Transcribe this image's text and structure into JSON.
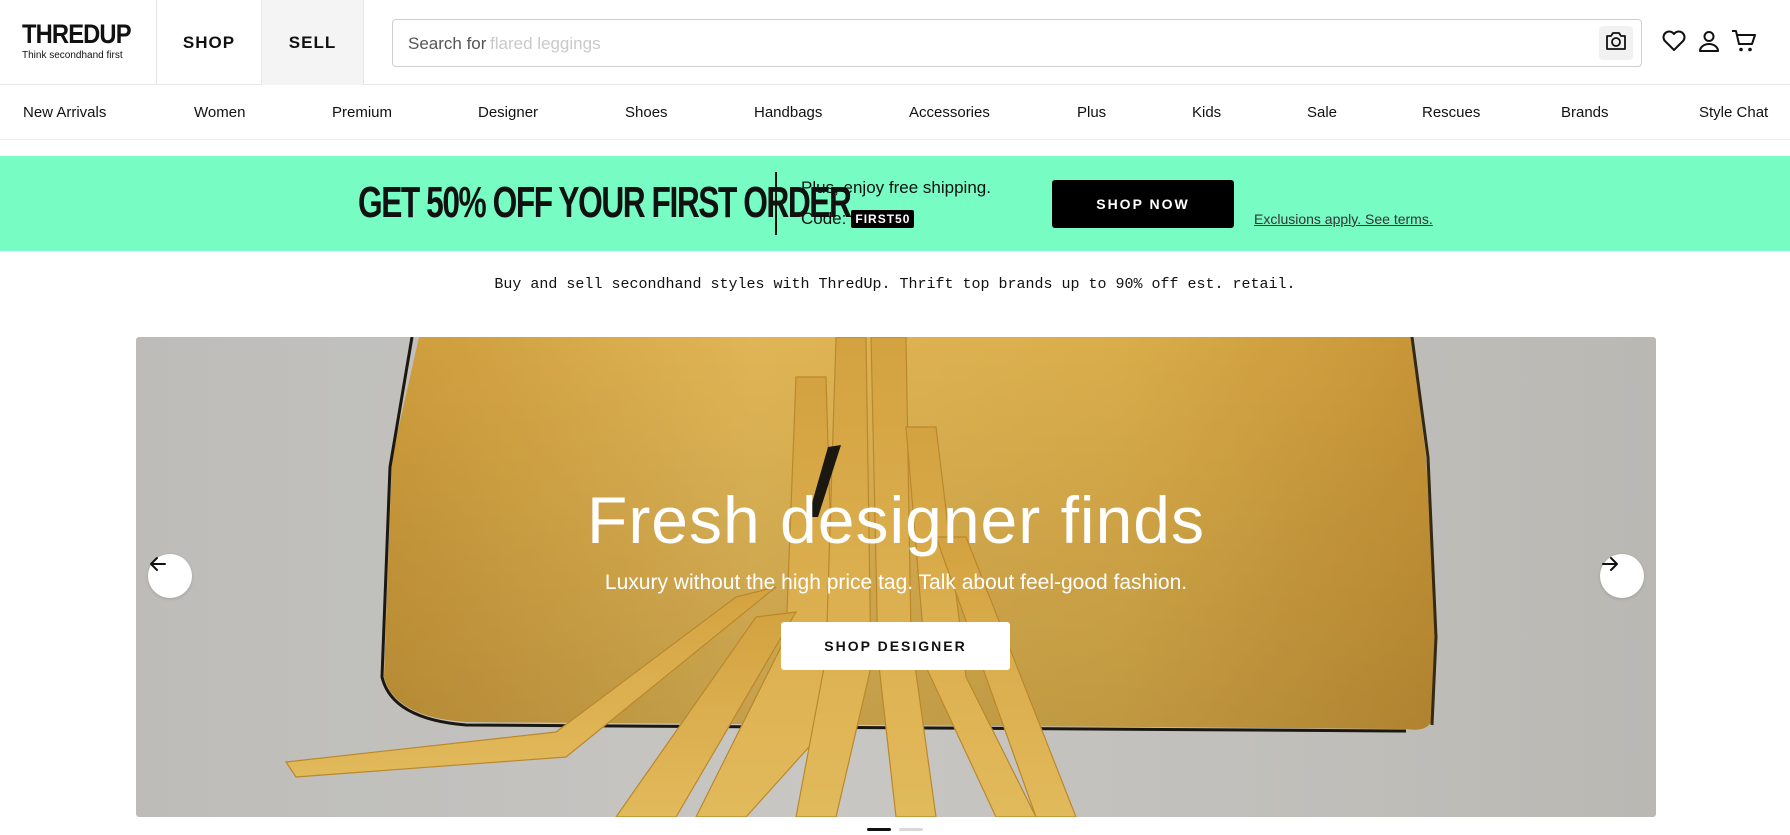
{
  "header": {
    "logo_text": "THREDUP",
    "logo_tagline": "Think secondhand first",
    "shop_label": "SHOP",
    "sell_label": "SELL",
    "search": {
      "prefix": "Search for",
      "placeholder": "flared leggings",
      "value": ""
    },
    "icons": [
      "camera-icon",
      "heart-icon",
      "user-icon",
      "cart-icon"
    ]
  },
  "categories": [
    "New Arrivals",
    "Women",
    "Premium",
    "Designer",
    "Shoes",
    "Handbags",
    "Accessories",
    "Plus",
    "Kids",
    "Sale",
    "Rescues",
    "Brands",
    "Style Chat"
  ],
  "promo": {
    "headline": "GET 50% OFF YOUR FIRST ORDER",
    "shipping": "Plus, enjoy free shipping.",
    "code_label": "Code:",
    "code": "FIRST50",
    "cta": "SHOP NOW",
    "terms": "Exclusions apply. See terms.",
    "bg_color": "#77fcc4"
  },
  "tagline": "Buy and sell secondhand styles with ThredUp. Thrift top brands up to 90% off est. retail.",
  "hero": {
    "title": "Fresh designer finds",
    "subtitle": "Luxury without the high price tag. Talk about feel-good fashion.",
    "cta": "SHOP DESIGNER",
    "slide_count": 2,
    "active_slide": 1,
    "accent_color": "#e8b84f"
  }
}
